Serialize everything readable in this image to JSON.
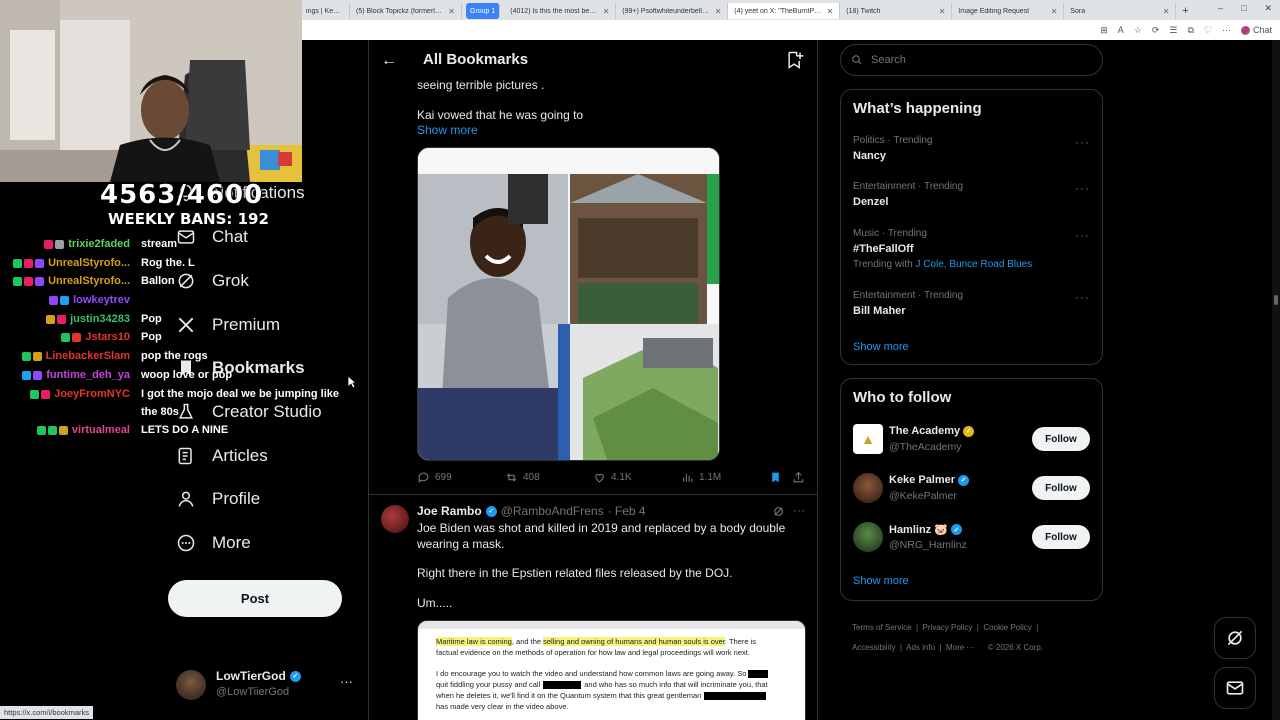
{
  "browser": {
    "tabs": [
      {
        "label": "ings | KevOnStr"
      },
      {
        "label": "(5) Block Topickz (formerly Glo"
      },
      {
        "label": "Group 1",
        "group": true
      },
      {
        "label": "(4012) Is this the most beautifu"
      },
      {
        "label": "(99+) PsoftwhiteunderbellyPcur"
      },
      {
        "label": "(4) yeet on X: \"TheBurntPeanut"
      },
      {
        "label": "(18) Twitch"
      },
      {
        "label": "Image Editing Request"
      },
      {
        "label": "Sora"
      }
    ],
    "new_tab": "+",
    "window_controls": [
      "–",
      "□",
      "✕"
    ],
    "addr_icons": [
      "⊞",
      "A",
      "☆",
      "⟳",
      "☰",
      "⧉",
      "♡",
      "⋯"
    ],
    "chat_label": "Chat",
    "status_url": "https://x.com/i/bookmarks"
  },
  "overlay": {
    "counter": "4563/4600",
    "weekly": "WEEKLY BANS: 192",
    "chat": [
      {
        "user": "trixie2faded",
        "msg": "stream",
        "color": "#5dd35b",
        "badges": [
          "#e91e63",
          "#9aa0a6"
        ]
      },
      {
        "user": "UnrealStyrofo...",
        "msg": "Rog the. L",
        "color": "#d4a017",
        "badges": [
          "#21c45d",
          "#e91e63",
          "#9147ff"
        ]
      },
      {
        "user": "UnrealStyrofo...",
        "msg": "Ballon",
        "color": "#d4a017",
        "badges": [
          "#21c45d",
          "#e91e63",
          "#9147ff"
        ]
      },
      {
        "user": "lowkeytrev",
        "msg": "",
        "color": "#9147ff",
        "badges": [
          "#9147ff",
          "#1da1f2"
        ]
      },
      {
        "user": "justin34283",
        "msg": "Pop",
        "color": "#3bbf6e",
        "badges": [
          "#d4a017",
          "#e91e63"
        ]
      },
      {
        "user": "Jstars10",
        "msg": "Pop",
        "color": "#e0362c",
        "badges": [
          "#21c45d",
          "#e0362c"
        ]
      },
      {
        "user": "LinebackerSlam",
        "msg": "pop the rogs",
        "color": "#e0362c",
        "badges": [
          "#21c45d",
          "#d4a017"
        ]
      },
      {
        "user": "funtime_deh_ya",
        "msg": "woop love or pop",
        "color": "#c246d6",
        "badges": [
          "#1da1f2",
          "#9147ff"
        ]
      },
      {
        "user": "JoeyFromNYC",
        "msg": "I got the mojo deal we be jumping like",
        "msg2": "the 80s",
        "color": "#e0362c",
        "badges": [
          "#21c45d",
          "#e91e63"
        ]
      },
      {
        "user": "virtualmeal",
        "msg": "LETS DO A NINE",
        "color": "#e0458a",
        "badges": [
          "#21c45d",
          "#21c45d",
          "#d4a017"
        ]
      }
    ]
  },
  "nav": {
    "notifications": "Notifications",
    "chat": "Chat",
    "grok": "Grok",
    "premium": "Premium",
    "bookmarks": "Bookmarks",
    "creator_studio": "Creator Studio",
    "articles": "Articles",
    "profile": "Profile",
    "more": "More",
    "post": "Post",
    "account_name": "LowTierGod",
    "account_handle": "@LowTiierGod",
    "account_more": "···"
  },
  "center": {
    "title": "All Bookmarks",
    "tweet1": {
      "line1": "seeing terrible pictures .",
      "line2": "Kai vowed that he was going to",
      "show_more": "Show more",
      "replies": "699",
      "reposts": "408",
      "likes": "4.1K",
      "views": "1.1M"
    },
    "tweet2": {
      "name": "Joe Rambo",
      "handle": "@RamboAndFrens",
      "date": "· Feb 4",
      "text1": "Joe Biden was shot and killed in 2019 and replaced by a body double",
      "text2": "wearing a mask.",
      "text3": "Right there in the Epstien related files released by the DOJ.",
      "text4": "Um.....",
      "doc_line1a": "Maritime law is coming",
      "doc_line1b": ", and the ",
      "doc_line1c": "selling and owning of humans and human souls is over",
      "doc_line1d": ". There is",
      "doc_line2": "factual evidence on the methods of operation for how law and legal proceedings will work next.",
      "doc_line3": "I do encourage you to watch the video and understand how common laws are going away. So",
      "doc_line4a": "quit fiddling your pussy and call",
      "doc_line4b": "and who has so much info that will incriminate you, that",
      "doc_line5": "when he deletes it, we'll find it on the Quantum system that this great gentleman",
      "doc_line6": "has made very clear in the video above."
    }
  },
  "search": {
    "placeholder": "Search"
  },
  "happening": {
    "title": "What’s happening",
    "trends": [
      {
        "meta": "Politics · Trending",
        "name": "Nancy"
      },
      {
        "meta": "Entertainment · Trending",
        "name": "Denzel"
      },
      {
        "meta": "Music · Trending",
        "name": "#TheFallOff",
        "with_label": "Trending with",
        "with_links": "J Cole, Bunce Road Blues"
      },
      {
        "meta": "Entertainment · Trending",
        "name": "Bill Maher"
      }
    ],
    "show_more": "Show more"
  },
  "who_to_follow": {
    "title": "Who to follow",
    "people": [
      {
        "name": "The Academy",
        "handle": "@TheAcademy",
        "badge_color": "#e2b719"
      },
      {
        "name": "Keke Palmer",
        "handle": "@KekePalmer",
        "badge_color": "#1d9bf0"
      },
      {
        "name": "Hamlinz 🐷",
        "handle": "@NRG_Hamlinz",
        "badge_color": "#1d9bf0"
      }
    ],
    "follow_label": "Follow",
    "show_more": "Show more"
  },
  "footer": {
    "links": [
      "Terms of Service",
      "Privacy Policy",
      "Cookie Policy",
      "Accessibility",
      "Ads info",
      "More ···",
      "© 2026 X Corp."
    ]
  },
  "colors": {
    "accent": "#1d9bf0",
    "border": "#2f3336",
    "muted": "#71767b"
  }
}
